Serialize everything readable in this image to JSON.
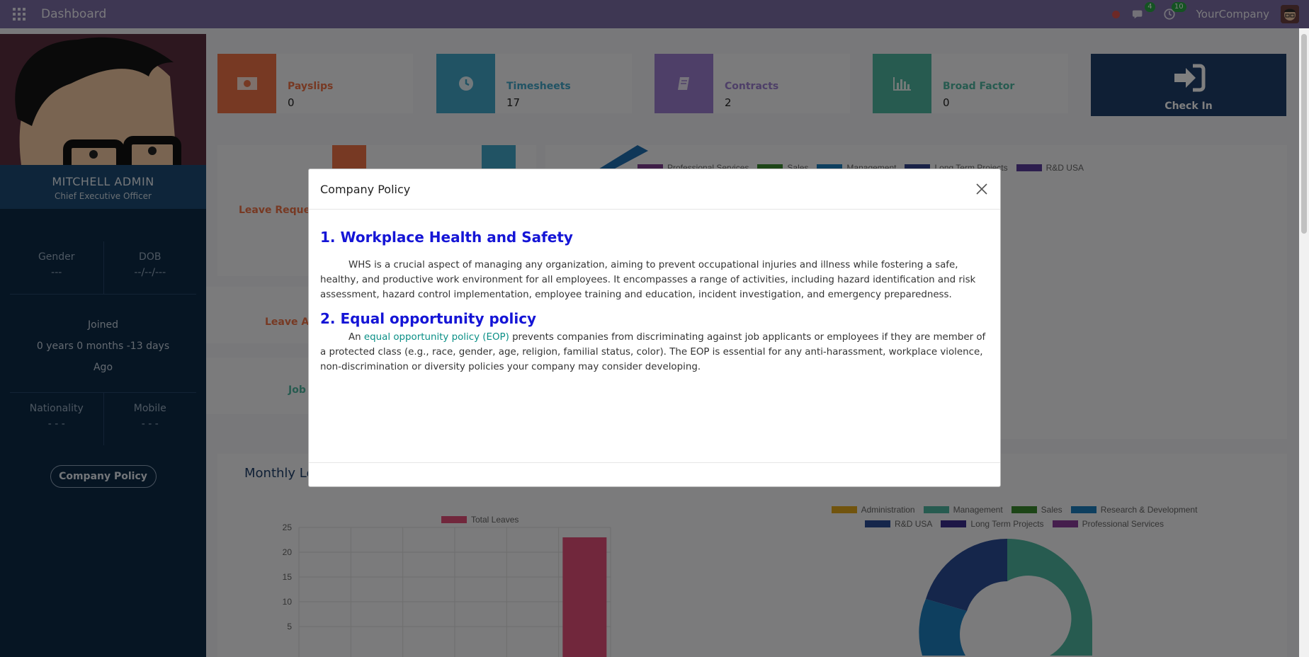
{
  "navbar": {
    "title": "Dashboard",
    "messages_count": "4",
    "activities_count": "10",
    "company": "YourCompany"
  },
  "profile": {
    "name": "MITCHELL ADMIN",
    "job": "Chief Executive Officer",
    "gender_label": "Gender",
    "gender_value": "---",
    "dob_label": "DOB",
    "dob_value": "--/--/---",
    "joined_label": "Joined",
    "joined_duration": "0 years 0 months -13 days",
    "joined_suffix": "Ago",
    "nationality_label": "Nationality",
    "nationality_value": "- - -",
    "mobile_label": "Mobile",
    "mobile_value": "- - -",
    "policy_button": "Company Policy"
  },
  "tiles": [
    {
      "label": "Payslips",
      "value": "0",
      "color": "#ef7346",
      "icon": "money-icon"
    },
    {
      "label": "Timesheets",
      "value": "17",
      "color": "#43a6c9",
      "icon": "clock-icon"
    },
    {
      "label": "Contracts",
      "value": "2",
      "color": "#9c7fd1",
      "icon": "book-icon"
    },
    {
      "label": "Broad Factor",
      "value": "0",
      "color": "#4fb7a1",
      "icon": "bar-chart-icon"
    }
  ],
  "checkin": {
    "label": "Check In",
    "icon": "sign-in-icon"
  },
  "background": {
    "leave_request": "Leave Request",
    "leave_alloc": "Leave All",
    "job": "Job",
    "monthly": "Monthly Le",
    "dept_legend_top": [
      "Professional Services",
      "Sales",
      "Management",
      "Long Term Projects",
      "R&D USA"
    ],
    "dept_legend_bottom": [
      "Administration",
      "Management",
      "Sales",
      "Research & Development",
      "R&D USA",
      "Long Term Projects",
      "Professional Services"
    ],
    "total_leaves_legend": "Total Leaves",
    "y_ticks": [
      "25",
      "20",
      "15",
      "10",
      "5"
    ]
  },
  "chart_data": [
    {
      "type": "bar",
      "series": [
        {
          "name": "Total Leaves",
          "values": [
            23
          ]
        }
      ],
      "ylim": [
        0,
        25
      ]
    },
    {
      "type": "pie",
      "categories": [
        "Administration",
        "Management",
        "Sales",
        "Research & Development",
        "R&D USA",
        "Long Term Projects",
        "Professional Services"
      ]
    }
  ],
  "modal": {
    "title": "Company Policy",
    "section1_heading": "1. Workplace Health and Safety",
    "section1_text": "WHS is a crucial aspect of managing any organization, aiming to prevent occupational injuries and illness while fostering a safe, healthy, and productive work environment for all employees. It encompasses a range of activities, including hazard identification and risk assessment, hazard control implementation, employee training and education, incident investigation, and emergency preparedness.",
    "section2_heading": "2.  Equal opportunity policy",
    "section2_prefix": "An",
    "section2_link": "equal opportunity policy (EOP)",
    "section2_text": "prevents companies from discriminating against job applicants or employees if they are member of a protected class (e.g., race, gender, age, religion, familial status, color). The EOP is essential for any anti-harassment, workplace violence, non-discrimination or diversity policies your company may consider developing."
  }
}
